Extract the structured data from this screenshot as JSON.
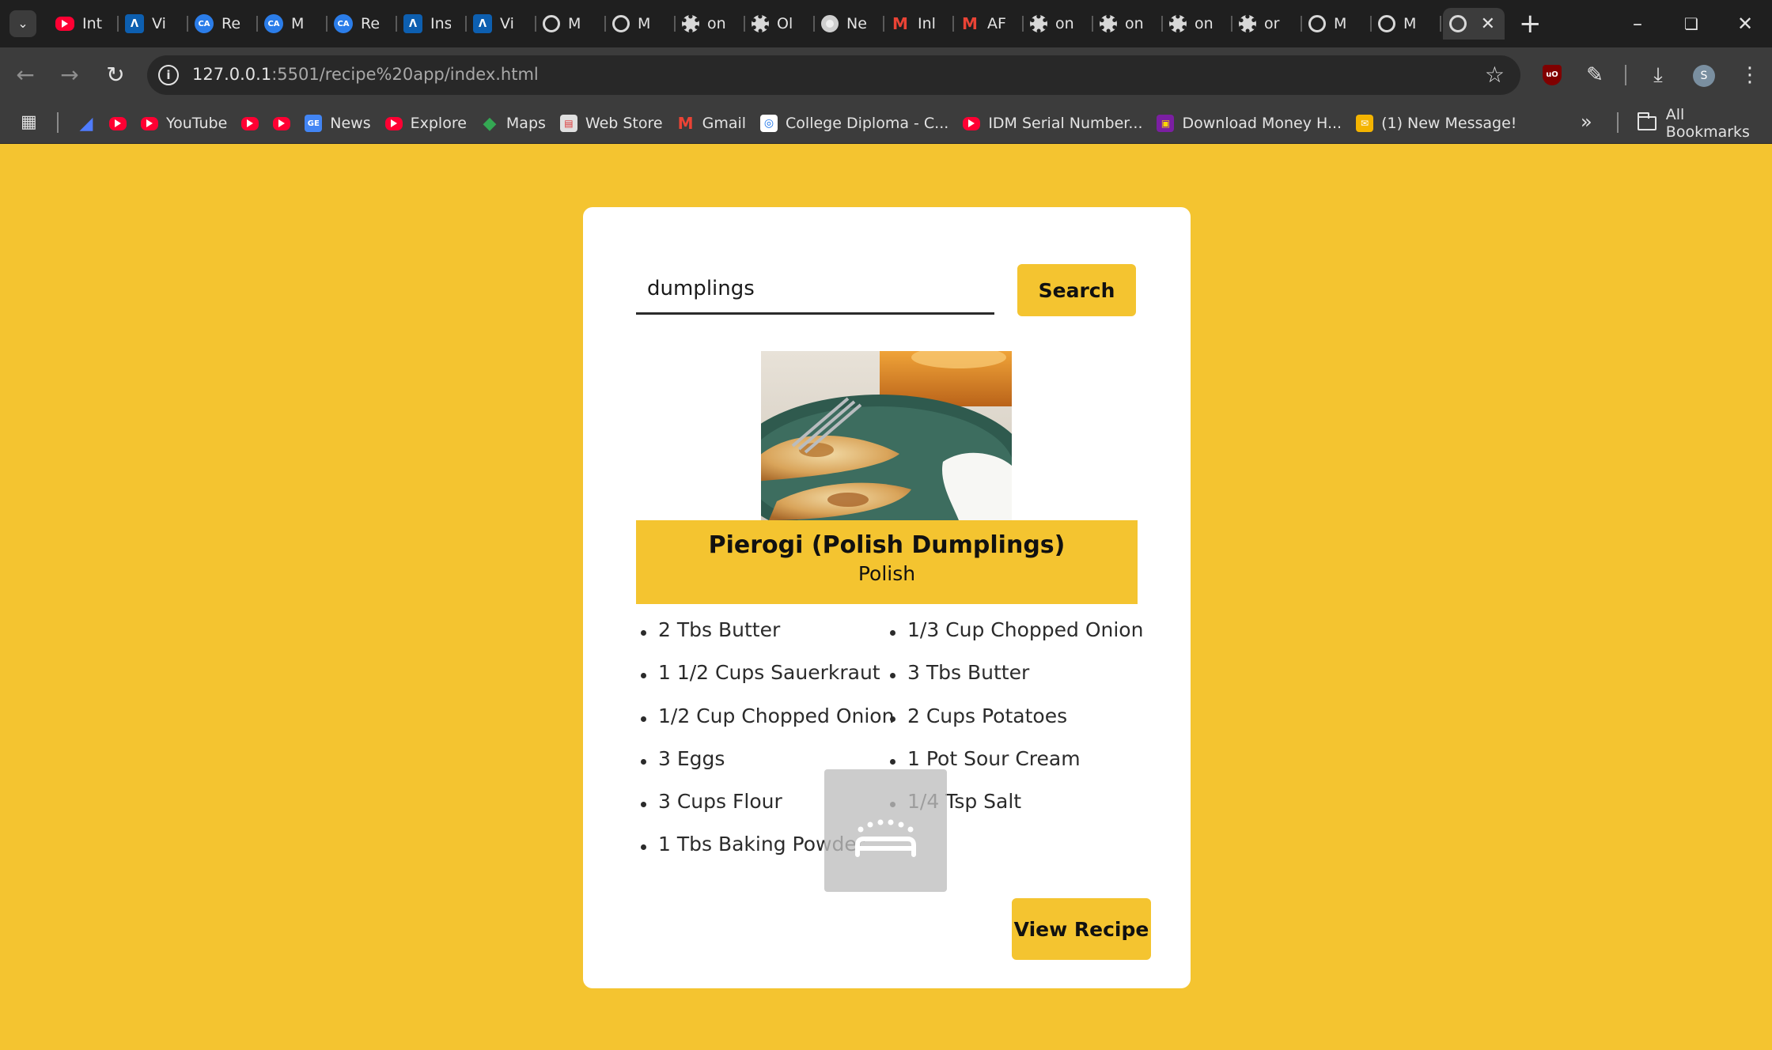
{
  "browser": {
    "tabs": [
      {
        "icon": "youtube-icon",
        "title": "Int"
      },
      {
        "icon": "a-icon",
        "title": "Vi"
      },
      {
        "icon": "ca-icon",
        "title": "Re"
      },
      {
        "icon": "ca-icon",
        "title": "M"
      },
      {
        "icon": "ca-icon",
        "title": "Re"
      },
      {
        "icon": "a-icon",
        "title": "Ins"
      },
      {
        "icon": "a-icon",
        "title": "Vi"
      },
      {
        "icon": "globe-icon",
        "title": "M"
      },
      {
        "icon": "globe-icon",
        "title": "M"
      },
      {
        "icon": "film-icon",
        "title": "on"
      },
      {
        "icon": "film-icon",
        "title": "Ol"
      },
      {
        "icon": "chrome-icon",
        "title": "Ne"
      },
      {
        "icon": "gmail-icon",
        "title": "Inl"
      },
      {
        "icon": "gmail-icon",
        "title": "AF"
      },
      {
        "icon": "film-icon",
        "title": "on"
      },
      {
        "icon": "film-icon",
        "title": "on"
      },
      {
        "icon": "film-icon",
        "title": "on"
      },
      {
        "icon": "film-icon",
        "title": "or"
      },
      {
        "icon": "globe-icon",
        "title": "M"
      },
      {
        "icon": "globe-icon",
        "title": "M"
      }
    ],
    "url_host": "127.0.0.1",
    "url_path": ":5501/recipe%20app/index.html",
    "profile_initial": "S",
    "bookmarks": [
      {
        "icon": "arrow-icon",
        "label": ""
      },
      {
        "icon": "youtube-icon",
        "label": ""
      },
      {
        "icon": "youtube-icon",
        "label": "YouTube"
      },
      {
        "icon": "youtube-icon",
        "label": ""
      },
      {
        "icon": "youtube-icon",
        "label": ""
      },
      {
        "icon": "news-icon",
        "label": "News"
      },
      {
        "icon": "youtube-icon",
        "label": "Explore"
      },
      {
        "icon": "maps-icon",
        "label": "Maps"
      },
      {
        "icon": "webstore-icon",
        "label": "Web Store"
      },
      {
        "icon": "gmail-icon",
        "label": "Gmail"
      },
      {
        "icon": "diploma-icon",
        "label": "College Diploma - C..."
      },
      {
        "icon": "youtube-icon",
        "label": "IDM Serial Number..."
      },
      {
        "icon": "money-icon",
        "label": "Download Money H..."
      },
      {
        "icon": "message-icon",
        "label": "(1) New Message!"
      }
    ],
    "all_bookmarks_label": "All Bookmarks"
  },
  "search": {
    "value": "dumplings",
    "button_label": "Search"
  },
  "recipe": {
    "image_alt": "Pierogi on a plate with a fork",
    "title": "Pierogi (Polish Dumplings)",
    "area": "Polish",
    "ingredients_left": [
      "2 Tbs Butter",
      "1 1/2 Cups Sauerkraut",
      "1/2 Cup Chopped Onion",
      "3 Eggs",
      "3 Cups Flour",
      "1 Tbs Baking Powder"
    ],
    "ingredients_right": [
      "1/3 Cup Chopped Onion",
      "3 Tbs Butter",
      "2 Cups Potatoes",
      "1 Pot Sour Cream",
      "1/4 Tsp Salt"
    ],
    "view_button_label": "View Recipe"
  },
  "colors": {
    "accent": "#f4c430",
    "card": "#ffffff",
    "text": "#2b2b2b"
  }
}
